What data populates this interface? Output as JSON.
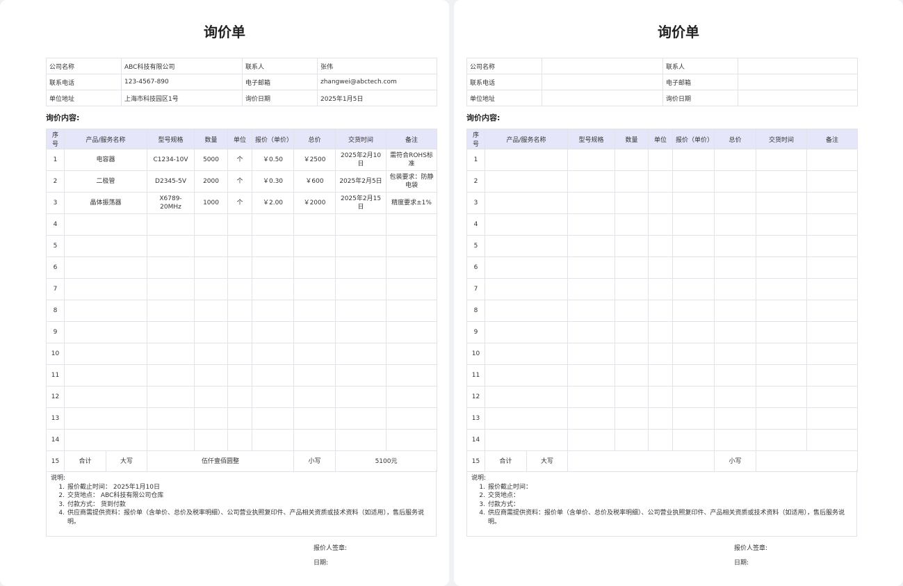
{
  "left": {
    "title": "询价单",
    "info": {
      "company_label": "公司名称",
      "company": "ABC科技有限公司",
      "contact_label": "联系人",
      "contact": "张伟",
      "phone_label": "联系电话",
      "phone": "123-4567-890",
      "email_label": "电子邮箱",
      "email": "zhangwei@abctech.com",
      "address_label": "单位地址",
      "address": "上海市科技园区1号",
      "date_label": "询价日期",
      "date": "2025年1月5日"
    },
    "section_title": "询价内容:",
    "headers": [
      "序号",
      "产品/服务名称",
      "型号规格",
      "数量",
      "单位",
      "报价（单价）",
      "总价",
      "交货时间",
      "备注"
    ],
    "rows": [
      [
        "1",
        "电容器",
        "C1234-10V",
        "5000",
        "个",
        "￥0.50",
        "￥2500",
        "2025年2月10日",
        "需符合ROHS标准"
      ],
      [
        "2",
        "二极管",
        "D2345-5V",
        "2000",
        "个",
        "￥0.30",
        "￥600",
        "2025年2月5日",
        "包装要求：防静电袋"
      ],
      [
        "3",
        "晶体振荡器",
        "X6789-20MHz",
        "1000",
        "个",
        "￥2.00",
        "￥2000",
        "2025年2月15日",
        "精度要求±1%"
      ],
      [
        "4",
        "",
        "",
        "",
        "",
        "",
        "",
        "",
        ""
      ],
      [
        "5",
        "",
        "",
        "",
        "",
        "",
        "",
        "",
        ""
      ],
      [
        "6",
        "",
        "",
        "",
        "",
        "",
        "",
        "",
        ""
      ],
      [
        "7",
        "",
        "",
        "",
        "",
        "",
        "",
        "",
        ""
      ],
      [
        "8",
        "",
        "",
        "",
        "",
        "",
        "",
        "",
        ""
      ],
      [
        "9",
        "",
        "",
        "",
        "",
        "",
        "",
        "",
        ""
      ],
      [
        "10",
        "",
        "",
        "",
        "",
        "",
        "",
        "",
        ""
      ],
      [
        "11",
        "",
        "",
        "",
        "",
        "",
        "",
        "",
        ""
      ],
      [
        "12",
        "",
        "",
        "",
        "",
        "",
        "",
        "",
        ""
      ],
      [
        "13",
        "",
        "",
        "",
        "",
        "",
        "",
        "",
        ""
      ],
      [
        "14",
        "",
        "",
        "",
        "",
        "",
        "",
        "",
        ""
      ]
    ],
    "sum": {
      "no": "15",
      "total_label": "合计",
      "upper_label": "大写",
      "upper": "伍仟壹佰圆整",
      "lower_label": "小写",
      "lower": "5100元"
    },
    "notes_title": "说明:",
    "notes": [
      {
        "num": "1.",
        "text": "报价截止时间：   2025年1月10日"
      },
      {
        "num": "2.",
        "text": "交货地点：   ABC科技有限公司仓库"
      },
      {
        "num": "3.",
        "text": "付款方式：   货到付款"
      },
      {
        "num": "4.",
        "text": "供应商需提供资料：报价单（含单价、总价及税率明细）、公司营业执照复印件、产品相关资质或技术资料（如适用），售后服务说明。"
      }
    ],
    "signer_label": "报价人签章:",
    "date_sign_label": "日期:"
  },
  "right": {
    "title": "询价单",
    "info": {
      "company_label": "公司名称",
      "company": "",
      "contact_label": "联系人",
      "contact": "",
      "phone_label": "联系电话",
      "phone": "",
      "email_label": "电子邮箱",
      "email": "",
      "address_label": "单位地址",
      "address": "",
      "date_label": "询价日期",
      "date": ""
    },
    "section_title": "询价内容:",
    "headers": [
      "序号",
      "产品/服务名称",
      "型号规格",
      "数量",
      "单位",
      "报价（单价）",
      "总价",
      "交货时间",
      "备注"
    ],
    "rows": [
      [
        "1",
        "",
        "",
        "",
        "",
        "",
        "",
        "",
        ""
      ],
      [
        "2",
        "",
        "",
        "",
        "",
        "",
        "",
        "",
        ""
      ],
      [
        "3",
        "",
        "",
        "",
        "",
        "",
        "",
        "",
        ""
      ],
      [
        "4",
        "",
        "",
        "",
        "",
        "",
        "",
        "",
        ""
      ],
      [
        "5",
        "",
        "",
        "",
        "",
        "",
        "",
        "",
        ""
      ],
      [
        "6",
        "",
        "",
        "",
        "",
        "",
        "",
        "",
        ""
      ],
      [
        "7",
        "",
        "",
        "",
        "",
        "",
        "",
        "",
        ""
      ],
      [
        "8",
        "",
        "",
        "",
        "",
        "",
        "",
        "",
        ""
      ],
      [
        "9",
        "",
        "",
        "",
        "",
        "",
        "",
        "",
        ""
      ],
      [
        "10",
        "",
        "",
        "",
        "",
        "",
        "",
        "",
        ""
      ],
      [
        "11",
        "",
        "",
        "",
        "",
        "",
        "",
        "",
        ""
      ],
      [
        "12",
        "",
        "",
        "",
        "",
        "",
        "",
        "",
        ""
      ],
      [
        "13",
        "",
        "",
        "",
        "",
        "",
        "",
        "",
        ""
      ],
      [
        "14",
        "",
        "",
        "",
        "",
        "",
        "",
        "",
        ""
      ]
    ],
    "sum": {
      "no": "15",
      "total_label": "合计",
      "upper_label": "大写",
      "upper": "",
      "lower_label": "小写",
      "lower": ""
    },
    "notes_title": "说明:",
    "notes": [
      {
        "num": "1.",
        "text": "报价截止时间："
      },
      {
        "num": "2.",
        "text": "交货地点："
      },
      {
        "num": "3.",
        "text": "付款方式："
      },
      {
        "num": "4.",
        "text": "供应商需提供资料：报价单（含单价、总价及税率明细）、公司营业执照复印件、产品相关资质或技术资料（如适用），售后服务说明。"
      }
    ],
    "signer_label": "报价人签章:",
    "date_sign_label": "日期:"
  }
}
